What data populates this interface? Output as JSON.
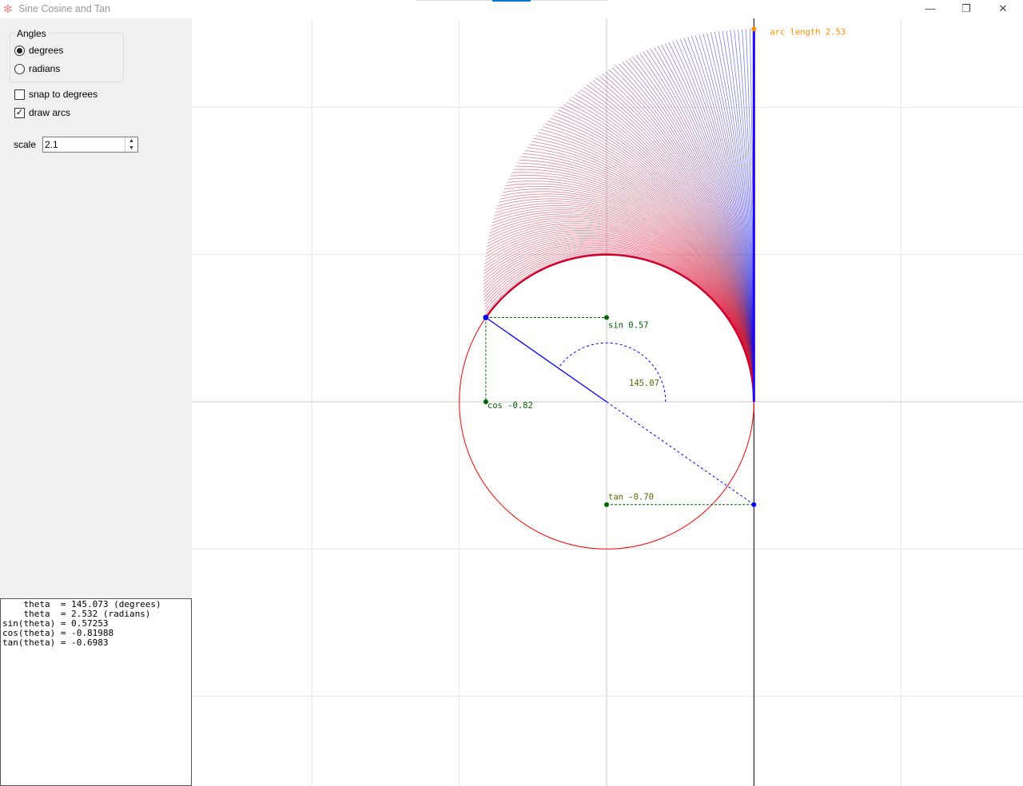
{
  "window": {
    "title": "Sine Cosine and Tan",
    "minimize": "—",
    "restore": "❐",
    "close": "✕"
  },
  "sidebar": {
    "group_label": "Angles",
    "degrees_label": "degrees",
    "degrees_selected": true,
    "radians_label": "radians",
    "radians_selected": false,
    "snap_label": "snap to degrees",
    "snap_checked": false,
    "arcs_label": "draw arcs",
    "arcs_checked": true,
    "scale_label": "scale",
    "scale_value": "2.1"
  },
  "output": {
    "lines": [
      "    theta  = 145.073 (degrees)",
      "    theta  = 2.532 (radians)",
      "sin(theta) = 0.57253",
      "cos(theta) = -0.81988",
      "tan(theta) = -0.6983"
    ]
  },
  "plot": {
    "theta_deg": 145.073,
    "sin_label": "sin 0.57",
    "cos_label": "cos -0.82",
    "tan_label": "tan -0.70",
    "angle_label": "145.07",
    "arc_label": "arc length 2.53",
    "colors": {
      "circle": "#ff0000",
      "radius": "#0000ff",
      "guide": "#006400",
      "arc_label": "#ff8c00",
      "grid": "#e6e6e6",
      "axis": "#c8c8c8"
    }
  }
}
